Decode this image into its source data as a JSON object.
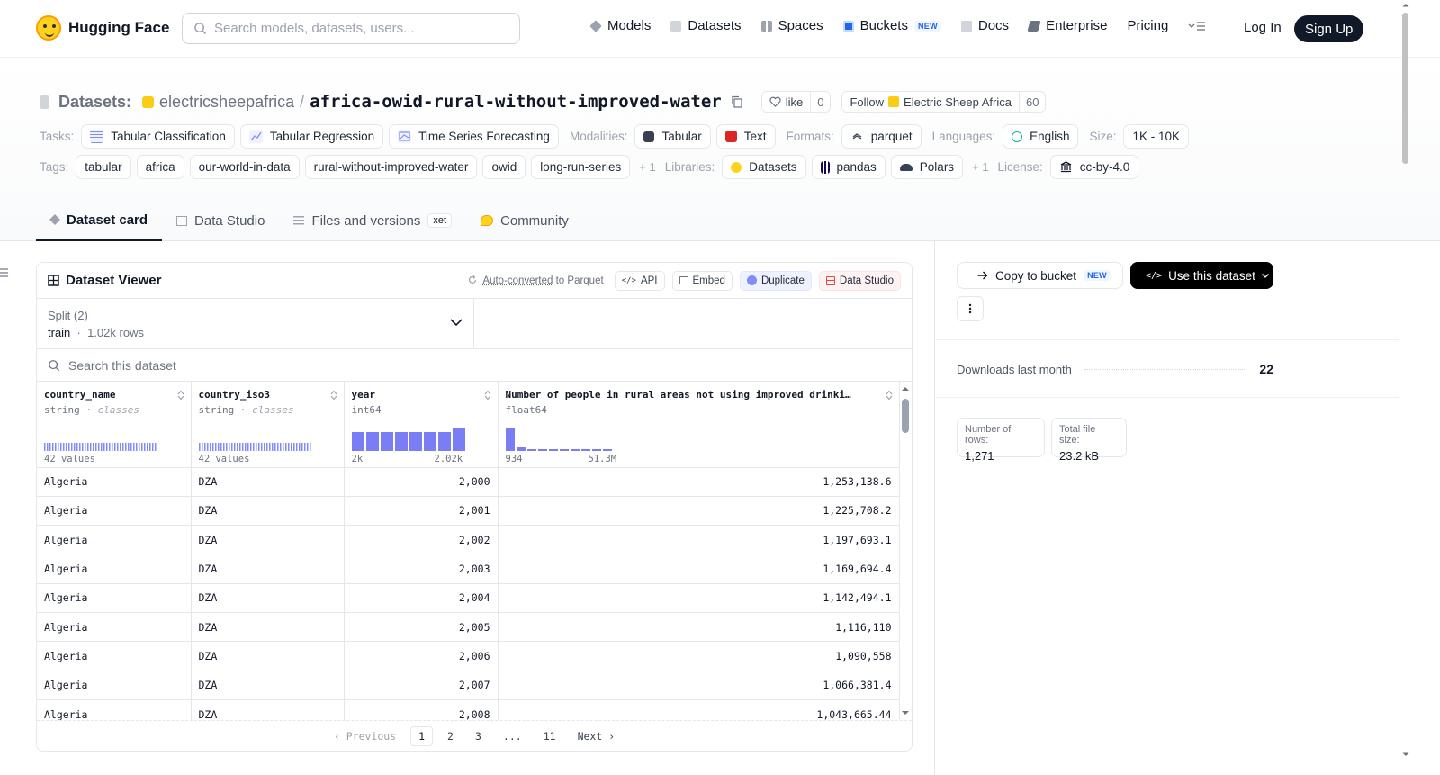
{
  "nav": {
    "brand": "Hugging Face",
    "search_placeholder": "Search models, datasets, users...",
    "links": [
      {
        "label": "Models",
        "icon": "cube-icon",
        "color": "#6b7280"
      },
      {
        "label": "Datasets",
        "icon": "database-icon",
        "color": "#9ca3af"
      },
      {
        "label": "Spaces",
        "icon": "grid-icon",
        "color": "#9ca3af"
      },
      {
        "label": "Buckets",
        "icon": "bucket-icon",
        "color": "#2563eb",
        "badge": "NEW"
      },
      {
        "label": "Docs",
        "icon": "book-icon",
        "color": "#9ca3af"
      },
      {
        "label": "Enterprise",
        "icon": "enterprise-icon",
        "color": "#6b7280"
      },
      {
        "label": "Pricing"
      }
    ],
    "login": "Log In",
    "signup": "Sign Up"
  },
  "repo": {
    "section": "Datasets:",
    "org": "electricsheepafrica",
    "name": "africa-owid-rural-without-improved-water",
    "like_label": "like",
    "like_count": "0",
    "follow_label": "Follow",
    "follow_org": "Electric Sheep Africa",
    "follow_count": "60"
  },
  "meta_row1": {
    "tasks_label": "Tasks:",
    "tasks": [
      "Tabular Classification",
      "Tabular Regression",
      "Time Series Forecasting"
    ],
    "modalities_label": "Modalities:",
    "modalities": [
      "Tabular",
      "Text"
    ],
    "formats_label": "Formats:",
    "formats": [
      "parquet"
    ],
    "languages_label": "Languages:",
    "languages": [
      "English"
    ],
    "size_label": "Size:",
    "size": "1K - 10K"
  },
  "meta_row2": {
    "tags_label": "Tags:",
    "tags": [
      "tabular",
      "africa",
      "our-world-in-data",
      "rural-without-improved-water",
      "owid",
      "long-run-series"
    ],
    "tags_more": "+ 1",
    "libraries_label": "Libraries:",
    "libraries": [
      "Datasets",
      "pandas",
      "Polars"
    ],
    "libraries_more": "+ 1",
    "license_label": "License:",
    "license": "cc-by-4.0"
  },
  "tabs": [
    {
      "label": "Dataset card",
      "active": true
    },
    {
      "label": "Data Studio"
    },
    {
      "label": "Files and versions",
      "badge": "xet"
    },
    {
      "label": "Community"
    }
  ],
  "viewer": {
    "title": "Dataset Viewer",
    "auto_converted": "Auto-converted",
    "to_parquet": "to Parquet",
    "buttons": [
      "API",
      "Embed",
      "Duplicate",
      "Data Studio"
    ],
    "split_label": "Split (2)",
    "split_value": "train",
    "split_rows": "1.02k rows",
    "search_placeholder": "Search this dataset",
    "columns": [
      {
        "name": "country_name",
        "type": "string",
        "kind": "classes",
        "footer": "42 values"
      },
      {
        "name": "country_iso3",
        "type": "string",
        "kind": "classes",
        "footer": "42 values"
      },
      {
        "name": "year",
        "type": "int64",
        "kind": "",
        "footer_min": "2k",
        "footer_max": "2.02k",
        "histogram": [
          0.8,
          0.8,
          0.8,
          0.8,
          0.8,
          0.8,
          0.8,
          1.0
        ]
      },
      {
        "name": "Number of people in rural areas not using improved drinki…",
        "type": "float64",
        "kind": "",
        "footer_min": "934",
        "footer_max": "51.3M",
        "histogram": [
          1.0,
          0.12,
          0.06,
          0.02,
          0.02,
          0.02,
          0.02,
          0.02,
          0.02,
          0.02
        ]
      }
    ],
    "rows": [
      [
        "Algeria",
        "DZA",
        "2,000",
        "1,253,138.6"
      ],
      [
        "Algeria",
        "DZA",
        "2,001",
        "1,225,708.2"
      ],
      [
        "Algeria",
        "DZA",
        "2,002",
        "1,197,693.1"
      ],
      [
        "Algeria",
        "DZA",
        "2,003",
        "1,169,694.4"
      ],
      [
        "Algeria",
        "DZA",
        "2,004",
        "1,142,494.1"
      ],
      [
        "Algeria",
        "DZA",
        "2,005",
        "1,116,110"
      ],
      [
        "Algeria",
        "DZA",
        "2,006",
        "1,090,558"
      ],
      [
        "Algeria",
        "DZA",
        "2,007",
        "1,066,381.4"
      ],
      [
        "Algeria",
        "DZA",
        "2,008",
        "1,043,665.44"
      ]
    ],
    "pager": {
      "previous": "Previous",
      "pages": [
        "1",
        "2",
        "3",
        "...",
        "11"
      ],
      "current": "1",
      "next": "Next"
    }
  },
  "sidebar": {
    "copy_label": "Copy to bucket",
    "copy_badge": "NEW",
    "use_label": "Use this dataset",
    "downloads_label": "Downloads last month",
    "downloads_value": "22",
    "rows_label": "Number of rows:",
    "rows_value": "1,271",
    "size_label": "Total file size:",
    "size_value": "23.2 kB"
  }
}
